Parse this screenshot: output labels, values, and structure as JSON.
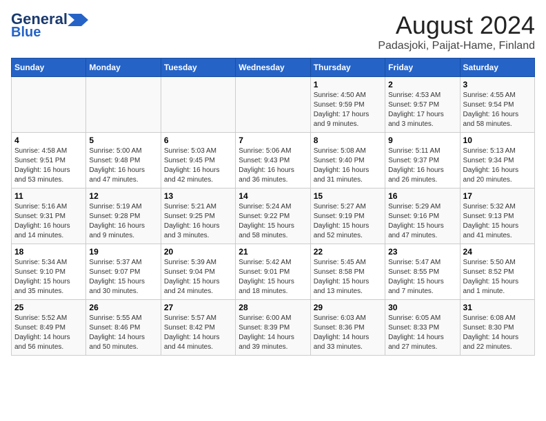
{
  "header": {
    "logo_line1": "General",
    "logo_line2": "Blue",
    "month_year": "August 2024",
    "location": "Padasjoki, Paijat-Hame, Finland"
  },
  "days_of_week": [
    "Sunday",
    "Monday",
    "Tuesday",
    "Wednesday",
    "Thursday",
    "Friday",
    "Saturday"
  ],
  "weeks": [
    [
      {
        "day": "",
        "info": ""
      },
      {
        "day": "",
        "info": ""
      },
      {
        "day": "",
        "info": ""
      },
      {
        "day": "",
        "info": ""
      },
      {
        "day": "1",
        "info": "Sunrise: 4:50 AM\nSunset: 9:59 PM\nDaylight: 17 hours\nand 9 minutes."
      },
      {
        "day": "2",
        "info": "Sunrise: 4:53 AM\nSunset: 9:57 PM\nDaylight: 17 hours\nand 3 minutes."
      },
      {
        "day": "3",
        "info": "Sunrise: 4:55 AM\nSunset: 9:54 PM\nDaylight: 16 hours\nand 58 minutes."
      }
    ],
    [
      {
        "day": "4",
        "info": "Sunrise: 4:58 AM\nSunset: 9:51 PM\nDaylight: 16 hours\nand 53 minutes."
      },
      {
        "day": "5",
        "info": "Sunrise: 5:00 AM\nSunset: 9:48 PM\nDaylight: 16 hours\nand 47 minutes."
      },
      {
        "day": "6",
        "info": "Sunrise: 5:03 AM\nSunset: 9:45 PM\nDaylight: 16 hours\nand 42 minutes."
      },
      {
        "day": "7",
        "info": "Sunrise: 5:06 AM\nSunset: 9:43 PM\nDaylight: 16 hours\nand 36 minutes."
      },
      {
        "day": "8",
        "info": "Sunrise: 5:08 AM\nSunset: 9:40 PM\nDaylight: 16 hours\nand 31 minutes."
      },
      {
        "day": "9",
        "info": "Sunrise: 5:11 AM\nSunset: 9:37 PM\nDaylight: 16 hours\nand 26 minutes."
      },
      {
        "day": "10",
        "info": "Sunrise: 5:13 AM\nSunset: 9:34 PM\nDaylight: 16 hours\nand 20 minutes."
      }
    ],
    [
      {
        "day": "11",
        "info": "Sunrise: 5:16 AM\nSunset: 9:31 PM\nDaylight: 16 hours\nand 14 minutes."
      },
      {
        "day": "12",
        "info": "Sunrise: 5:19 AM\nSunset: 9:28 PM\nDaylight: 16 hours\nand 9 minutes."
      },
      {
        "day": "13",
        "info": "Sunrise: 5:21 AM\nSunset: 9:25 PM\nDaylight: 16 hours\nand 3 minutes."
      },
      {
        "day": "14",
        "info": "Sunrise: 5:24 AM\nSunset: 9:22 PM\nDaylight: 15 hours\nand 58 minutes."
      },
      {
        "day": "15",
        "info": "Sunrise: 5:27 AM\nSunset: 9:19 PM\nDaylight: 15 hours\nand 52 minutes."
      },
      {
        "day": "16",
        "info": "Sunrise: 5:29 AM\nSunset: 9:16 PM\nDaylight: 15 hours\nand 47 minutes."
      },
      {
        "day": "17",
        "info": "Sunrise: 5:32 AM\nSunset: 9:13 PM\nDaylight: 15 hours\nand 41 minutes."
      }
    ],
    [
      {
        "day": "18",
        "info": "Sunrise: 5:34 AM\nSunset: 9:10 PM\nDaylight: 15 hours\nand 35 minutes."
      },
      {
        "day": "19",
        "info": "Sunrise: 5:37 AM\nSunset: 9:07 PM\nDaylight: 15 hours\nand 30 minutes."
      },
      {
        "day": "20",
        "info": "Sunrise: 5:39 AM\nSunset: 9:04 PM\nDaylight: 15 hours\nand 24 minutes."
      },
      {
        "day": "21",
        "info": "Sunrise: 5:42 AM\nSunset: 9:01 PM\nDaylight: 15 hours\nand 18 minutes."
      },
      {
        "day": "22",
        "info": "Sunrise: 5:45 AM\nSunset: 8:58 PM\nDaylight: 15 hours\nand 13 minutes."
      },
      {
        "day": "23",
        "info": "Sunrise: 5:47 AM\nSunset: 8:55 PM\nDaylight: 15 hours\nand 7 minutes."
      },
      {
        "day": "24",
        "info": "Sunrise: 5:50 AM\nSunset: 8:52 PM\nDaylight: 15 hours\nand 1 minute."
      }
    ],
    [
      {
        "day": "25",
        "info": "Sunrise: 5:52 AM\nSunset: 8:49 PM\nDaylight: 14 hours\nand 56 minutes."
      },
      {
        "day": "26",
        "info": "Sunrise: 5:55 AM\nSunset: 8:46 PM\nDaylight: 14 hours\nand 50 minutes."
      },
      {
        "day": "27",
        "info": "Sunrise: 5:57 AM\nSunset: 8:42 PM\nDaylight: 14 hours\nand 44 minutes."
      },
      {
        "day": "28",
        "info": "Sunrise: 6:00 AM\nSunset: 8:39 PM\nDaylight: 14 hours\nand 39 minutes."
      },
      {
        "day": "29",
        "info": "Sunrise: 6:03 AM\nSunset: 8:36 PM\nDaylight: 14 hours\nand 33 minutes."
      },
      {
        "day": "30",
        "info": "Sunrise: 6:05 AM\nSunset: 8:33 PM\nDaylight: 14 hours\nand 27 minutes."
      },
      {
        "day": "31",
        "info": "Sunrise: 6:08 AM\nSunset: 8:30 PM\nDaylight: 14 hours\nand 22 minutes."
      }
    ]
  ]
}
